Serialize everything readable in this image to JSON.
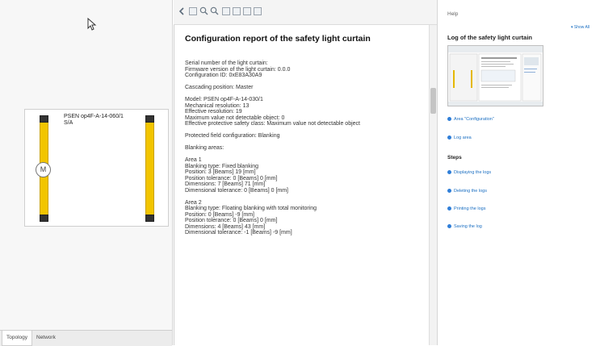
{
  "left": {
    "device_label": "PSEN op4F-A-14-060/1\nS/A",
    "knob_label": "M",
    "tabs": [
      "Topology",
      "Network"
    ]
  },
  "report": {
    "title": "Configuration report of the safety light curtain",
    "lines": [
      "Serial number of the light curtain:",
      "Firmware version of the light curtain: 0.0.0",
      "Configuration ID: 0xE83A30A9",
      "",
      "Cascading position: Master",
      "",
      "Model: PSEN op4F-A-14-030/1",
      "Mechanical resolution: 13",
      "Effective resolution: 19",
      "Maximum value not detectable object: 0",
      "Effective protective safety class: Maximum value not detectable object",
      "",
      "Protected field configuration: Blanking",
      "",
      "Blanking areas:",
      "",
      "Area 1",
      "Blanking type: Fixed blanking",
      "Position: 3 [Beams]   19 [mm]",
      "Position tolerance: 0 [Beams]   0 [mm]",
      "Dimensions: 7 [Beams]   71 [mm]",
      "Dimensional tolerance: 0 [Beams]   0 [mm]",
      "",
      "Area 2",
      "Blanking type: Floating blanking with total monitoring",
      "Position: 0 [Beams]   -9 [mm]",
      "Position tolerance: 0 [Beams]   0 [mm]",
      "Dimensions: 4 [Beams]   43 [mm]",
      "Dimensional tolerance: -1 [Beams]   -9 [mm]"
    ]
  },
  "help": {
    "label": "Help",
    "show_all": "▾ Show All",
    "title": "Log of the safety light curtain",
    "links": [
      "Area \"Configuration\"",
      "Log area"
    ],
    "steps_heading": "Steps",
    "steps": [
      "Displaying the logs",
      "Deleting the logs",
      "Printing the logs",
      "Saving the log"
    ]
  },
  "toolbar_icons": [
    "back-icon",
    "page-icon",
    "zoom-in-icon",
    "zoom-out-icon",
    "view-single-icon",
    "view-double-icon",
    "view-grid-icon",
    "view-list-icon"
  ]
}
